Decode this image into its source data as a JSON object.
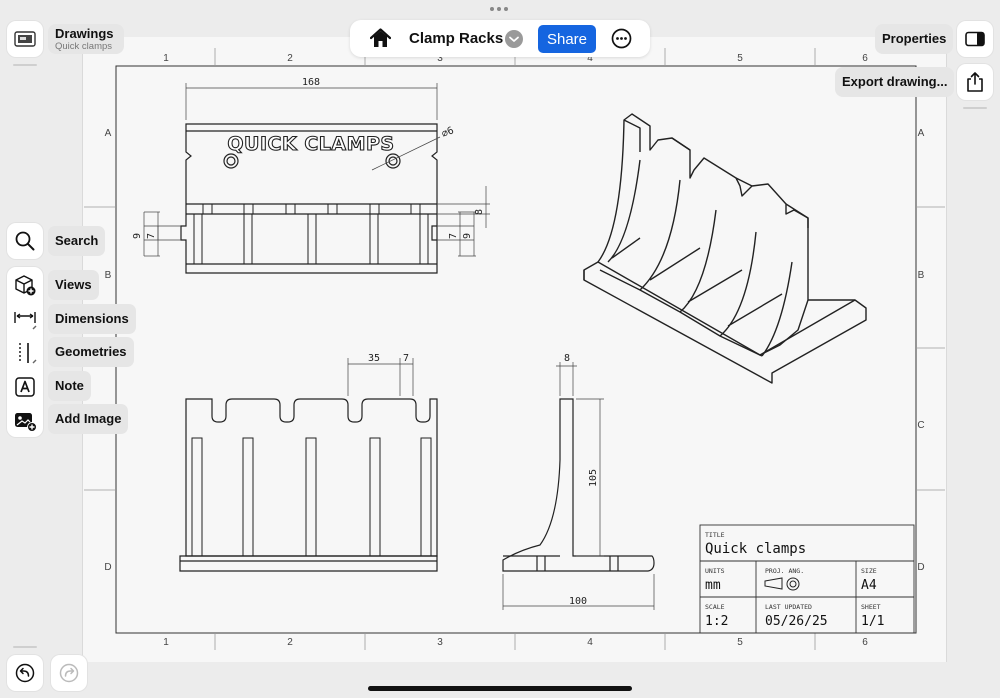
{
  "app": {
    "drawings_label": "Drawings",
    "drawings_subtitle": "Quick clamps"
  },
  "toolbar": {
    "document_title": "Clamp Racks",
    "share_label": "Share"
  },
  "right_panel": {
    "properties_label": "Properties",
    "export_label": "Export drawing..."
  },
  "tools": {
    "search_label": "Search",
    "views_label": "Views",
    "dimensions_label": "Dimensions",
    "geometries_label": "Geometries",
    "note_label": "Note",
    "add_image_label": "Add Image"
  },
  "rulers": {
    "columns": [
      "1",
      "2",
      "3",
      "4",
      "5",
      "6"
    ],
    "rows": [
      "A",
      "B",
      "C",
      "D"
    ]
  },
  "dimensions": {
    "top_width": "168",
    "hole_diameter": "⌀6",
    "left_small_outer": "9",
    "left_small_inner": "7",
    "right_small_inner": "7",
    "right_small_outer": "9",
    "right_top": "8",
    "slot_pitch": "35",
    "slot_width": "7",
    "side_thickness": "8",
    "side_height": "105",
    "side_base": "100"
  },
  "part_label": "QUICK CLAMPS",
  "title_block": {
    "title_label": "TITLE",
    "title_value": "Quick clamps",
    "units_label": "UNITS",
    "units_value": "mm",
    "proj_label": "PROJ. ANG.",
    "size_label": "SIZE",
    "size_value": "A4",
    "scale_label": "SCALE",
    "scale_value": "1:2",
    "updated_label": "LAST UPDATED",
    "updated_value": "05/26/25",
    "sheet_label": "SHEET",
    "sheet_value": "1/1"
  }
}
